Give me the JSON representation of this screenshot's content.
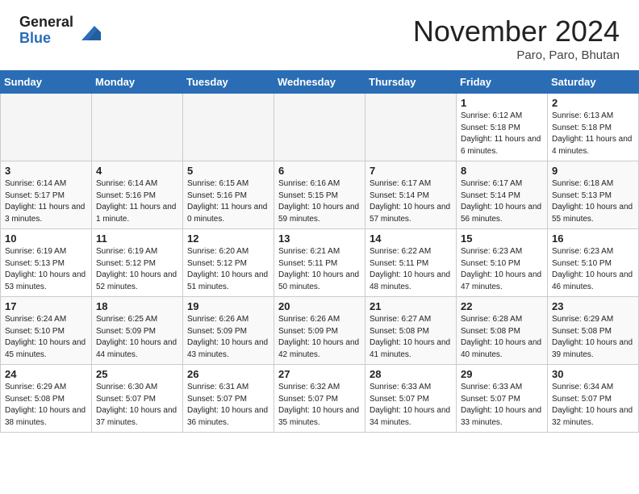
{
  "header": {
    "logo_general": "General",
    "logo_blue": "Blue",
    "month_title": "November 2024",
    "location": "Paro, Paro, Bhutan"
  },
  "weekdays": [
    "Sunday",
    "Monday",
    "Tuesday",
    "Wednesday",
    "Thursday",
    "Friday",
    "Saturday"
  ],
  "weeks": [
    [
      {
        "day": "",
        "empty": true
      },
      {
        "day": "",
        "empty": true
      },
      {
        "day": "",
        "empty": true
      },
      {
        "day": "",
        "empty": true
      },
      {
        "day": "",
        "empty": true
      },
      {
        "day": "1",
        "sunrise": "6:12 AM",
        "sunset": "5:18 PM",
        "daylight": "11 hours and 6 minutes."
      },
      {
        "day": "2",
        "sunrise": "6:13 AM",
        "sunset": "5:18 PM",
        "daylight": "11 hours and 4 minutes."
      }
    ],
    [
      {
        "day": "3",
        "sunrise": "6:14 AM",
        "sunset": "5:17 PM",
        "daylight": "11 hours and 3 minutes."
      },
      {
        "day": "4",
        "sunrise": "6:14 AM",
        "sunset": "5:16 PM",
        "daylight": "11 hours and 1 minute."
      },
      {
        "day": "5",
        "sunrise": "6:15 AM",
        "sunset": "5:16 PM",
        "daylight": "11 hours and 0 minutes."
      },
      {
        "day": "6",
        "sunrise": "6:16 AM",
        "sunset": "5:15 PM",
        "daylight": "10 hours and 59 minutes."
      },
      {
        "day": "7",
        "sunrise": "6:17 AM",
        "sunset": "5:14 PM",
        "daylight": "10 hours and 57 minutes."
      },
      {
        "day": "8",
        "sunrise": "6:17 AM",
        "sunset": "5:14 PM",
        "daylight": "10 hours and 56 minutes."
      },
      {
        "day": "9",
        "sunrise": "6:18 AM",
        "sunset": "5:13 PM",
        "daylight": "10 hours and 55 minutes."
      }
    ],
    [
      {
        "day": "10",
        "sunrise": "6:19 AM",
        "sunset": "5:13 PM",
        "daylight": "10 hours and 53 minutes."
      },
      {
        "day": "11",
        "sunrise": "6:19 AM",
        "sunset": "5:12 PM",
        "daylight": "10 hours and 52 minutes."
      },
      {
        "day": "12",
        "sunrise": "6:20 AM",
        "sunset": "5:12 PM",
        "daylight": "10 hours and 51 minutes."
      },
      {
        "day": "13",
        "sunrise": "6:21 AM",
        "sunset": "5:11 PM",
        "daylight": "10 hours and 50 minutes."
      },
      {
        "day": "14",
        "sunrise": "6:22 AM",
        "sunset": "5:11 PM",
        "daylight": "10 hours and 48 minutes."
      },
      {
        "day": "15",
        "sunrise": "6:23 AM",
        "sunset": "5:10 PM",
        "daylight": "10 hours and 47 minutes."
      },
      {
        "day": "16",
        "sunrise": "6:23 AM",
        "sunset": "5:10 PM",
        "daylight": "10 hours and 46 minutes."
      }
    ],
    [
      {
        "day": "17",
        "sunrise": "6:24 AM",
        "sunset": "5:10 PM",
        "daylight": "10 hours and 45 minutes."
      },
      {
        "day": "18",
        "sunrise": "6:25 AM",
        "sunset": "5:09 PM",
        "daylight": "10 hours and 44 minutes."
      },
      {
        "day": "19",
        "sunrise": "6:26 AM",
        "sunset": "5:09 PM",
        "daylight": "10 hours and 43 minutes."
      },
      {
        "day": "20",
        "sunrise": "6:26 AM",
        "sunset": "5:09 PM",
        "daylight": "10 hours and 42 minutes."
      },
      {
        "day": "21",
        "sunrise": "6:27 AM",
        "sunset": "5:08 PM",
        "daylight": "10 hours and 41 minutes."
      },
      {
        "day": "22",
        "sunrise": "6:28 AM",
        "sunset": "5:08 PM",
        "daylight": "10 hours and 40 minutes."
      },
      {
        "day": "23",
        "sunrise": "6:29 AM",
        "sunset": "5:08 PM",
        "daylight": "10 hours and 39 minutes."
      }
    ],
    [
      {
        "day": "24",
        "sunrise": "6:29 AM",
        "sunset": "5:08 PM",
        "daylight": "10 hours and 38 minutes."
      },
      {
        "day": "25",
        "sunrise": "6:30 AM",
        "sunset": "5:07 PM",
        "daylight": "10 hours and 37 minutes."
      },
      {
        "day": "26",
        "sunrise": "6:31 AM",
        "sunset": "5:07 PM",
        "daylight": "10 hours and 36 minutes."
      },
      {
        "day": "27",
        "sunrise": "6:32 AM",
        "sunset": "5:07 PM",
        "daylight": "10 hours and 35 minutes."
      },
      {
        "day": "28",
        "sunrise": "6:33 AM",
        "sunset": "5:07 PM",
        "daylight": "10 hours and 34 minutes."
      },
      {
        "day": "29",
        "sunrise": "6:33 AM",
        "sunset": "5:07 PM",
        "daylight": "10 hours and 33 minutes."
      },
      {
        "day": "30",
        "sunrise": "6:34 AM",
        "sunset": "5:07 PM",
        "daylight": "10 hours and 32 minutes."
      }
    ]
  ]
}
